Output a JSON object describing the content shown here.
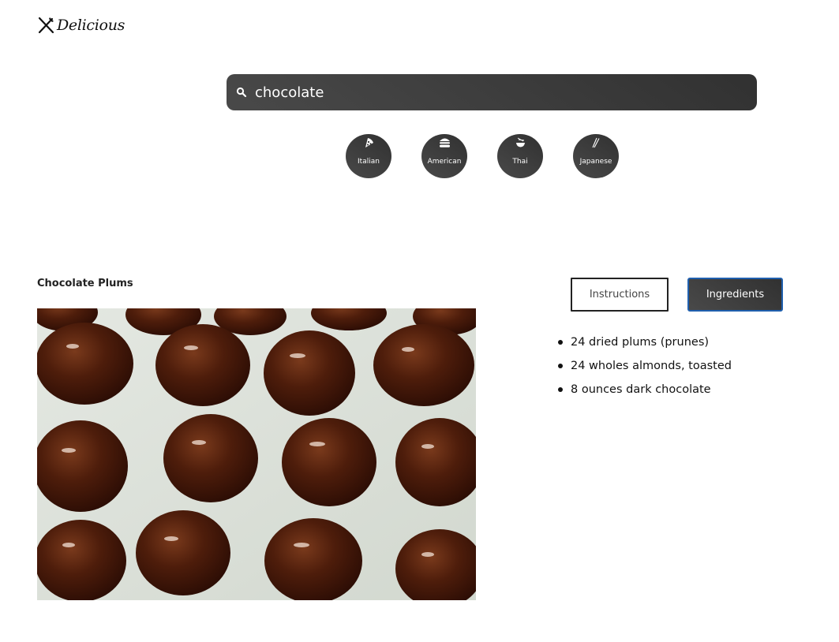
{
  "brand": {
    "name": "Delicious"
  },
  "search": {
    "value": "chocolate",
    "placeholder": ""
  },
  "cuisines": [
    {
      "label": "Italian",
      "icon": "pizza-icon"
    },
    {
      "label": "American",
      "icon": "burger-icon"
    },
    {
      "label": "Thai",
      "icon": "noodle-bowl-icon"
    },
    {
      "label": "Japanese",
      "icon": "chopsticks-icon"
    }
  ],
  "recipe": {
    "title": "Chocolate Plums",
    "image": "chocolate-covered-plums-photo",
    "tabs": {
      "instructions": "Instructions",
      "ingredients": "Ingredients",
      "active": "ingredients"
    },
    "ingredients": [
      "24 dried plums (prunes)",
      "24 wholes almonds, toasted",
      "8 ounces dark chocolate"
    ]
  },
  "colors": {
    "accent_dark": "#313131",
    "accent_light": "#494949",
    "active_border": "#1f5fae"
  }
}
